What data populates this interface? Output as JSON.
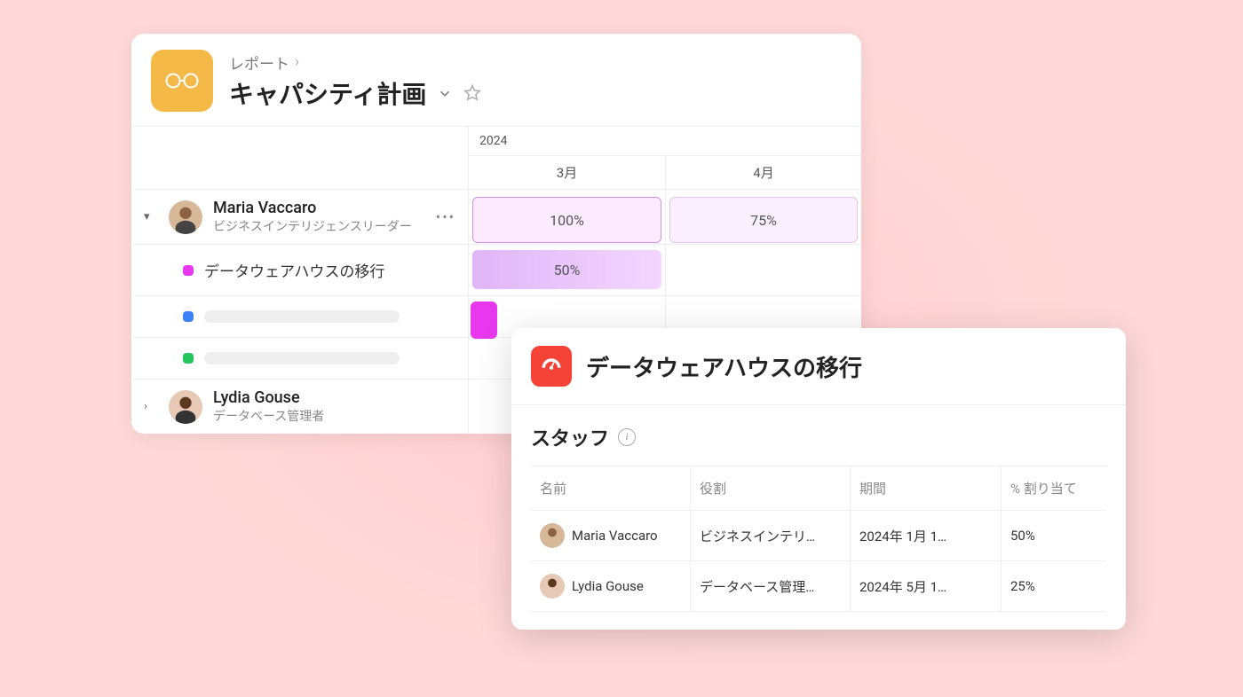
{
  "header": {
    "breadcrumb": "レポート",
    "title": "キャパシティ計画"
  },
  "timeline": {
    "year": "2024",
    "months": [
      "3月",
      "4月"
    ]
  },
  "people": [
    {
      "name": "Maria Vaccaro",
      "role": "ビジネスインテリジェンスリーダー",
      "expanded": true,
      "allocations": {
        "month1": "100%",
        "month2": "75%"
      },
      "tasks": [
        {
          "color": "magenta",
          "label": "データウェアハウスの移行",
          "bar": "50%"
        },
        {
          "color": "blue"
        },
        {
          "color": "green"
        }
      ]
    },
    {
      "name": "Lydia Gouse",
      "role": "データベース管理者",
      "expanded": false
    }
  ],
  "detail": {
    "title": "データウェアハウスの移行",
    "staff_label": "スタッフ",
    "columns": {
      "name": "名前",
      "role": "役割",
      "period": "期間",
      "alloc": "% 割り当て"
    },
    "rows": [
      {
        "name": "Maria Vaccaro",
        "role": "ビジネスインテリ…",
        "period": "2024年 1月 1…",
        "alloc": "50%"
      },
      {
        "name": "Lydia Gouse",
        "role": "データベース管理…",
        "period": "2024年 5月 1…",
        "alloc": "25%"
      }
    ]
  }
}
